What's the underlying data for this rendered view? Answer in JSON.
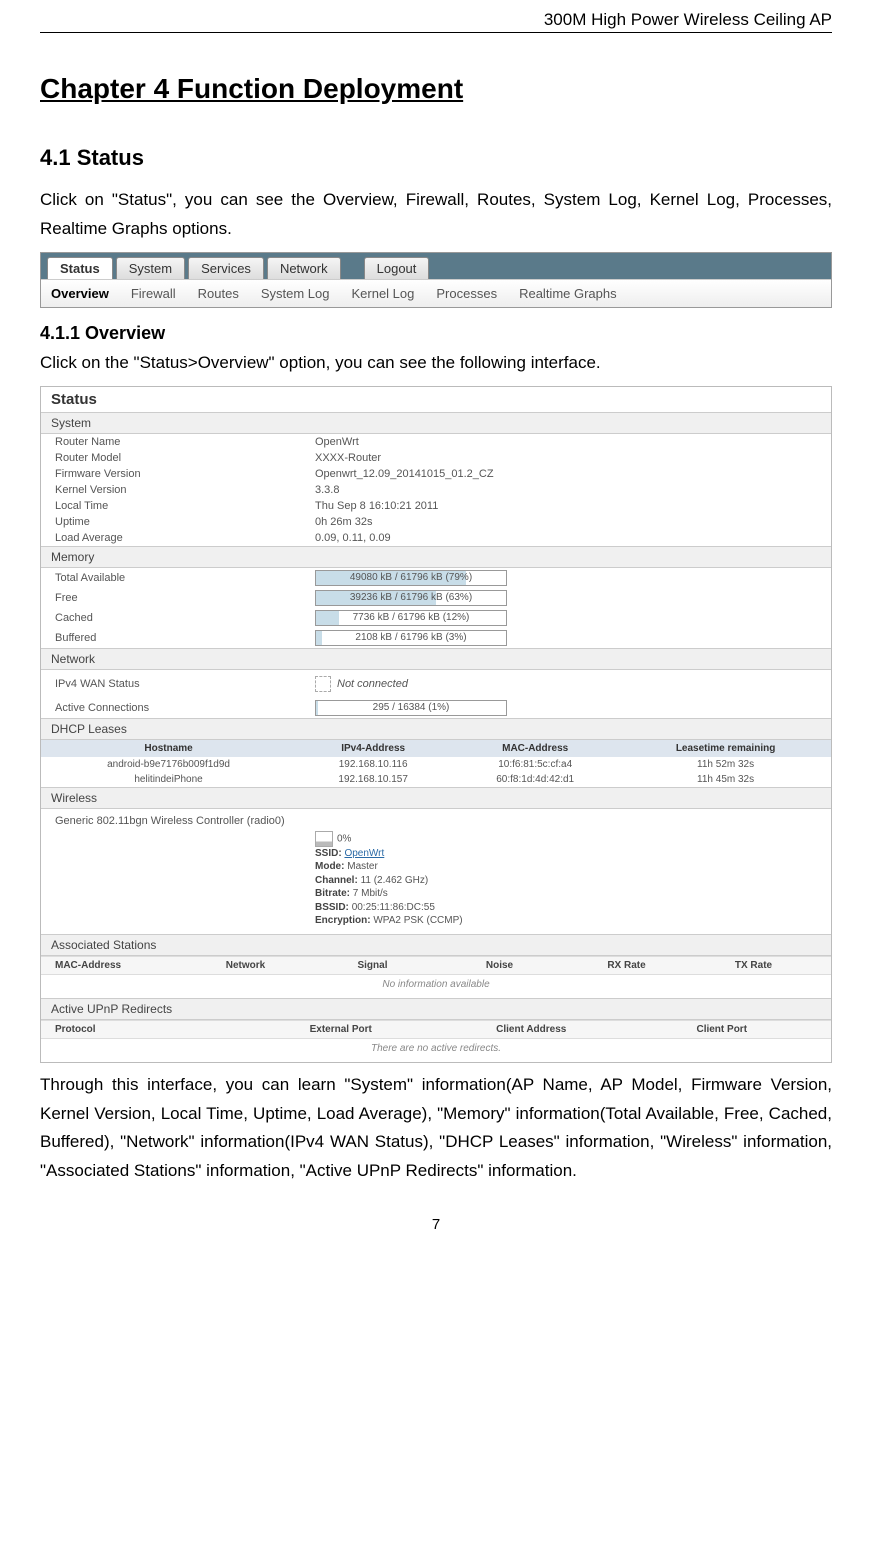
{
  "header": {
    "title": "300M High Power Wireless Ceiling AP"
  },
  "chapter": {
    "title": "Chapter 4 Function Deployment"
  },
  "section41": {
    "title": "4.1 Status",
    "body": "Click on \"Status\", you can see the Overview, Firewall, Routes, System Log, Kernel Log, Processes, Realtime Graphs options."
  },
  "screenshot1": {
    "tabs": [
      "Status",
      "System",
      "Services",
      "Network",
      "Logout"
    ],
    "subtabs": [
      "Overview",
      "Firewall",
      "Routes",
      "System Log",
      "Kernel Log",
      "Processes",
      "Realtime Graphs"
    ]
  },
  "section411": {
    "title": "4.1.1 Overview",
    "intro": "Click on the \"Status>Overview\" option, you can see the following interface."
  },
  "status": {
    "title": "Status",
    "system": {
      "heading": "System",
      "rows": [
        {
          "k": "Router Name",
          "v": "OpenWrt"
        },
        {
          "k": "Router Model",
          "v": "XXXX-Router"
        },
        {
          "k": "Firmware Version",
          "v": "Openwrt_12.09_20141015_01.2_CZ"
        },
        {
          "k": "Kernel Version",
          "v": "3.3.8"
        },
        {
          "k": "Local Time",
          "v": "Thu Sep 8 16:10:21 2011"
        },
        {
          "k": "Uptime",
          "v": "0h 26m 32s"
        },
        {
          "k": "Load Average",
          "v": "0.09, 0.11, 0.09"
        }
      ]
    },
    "memory": {
      "heading": "Memory",
      "rows": [
        {
          "k": "Total Available",
          "label": "49080 kB / 61796 kB (79%)",
          "pct": 79
        },
        {
          "k": "Free",
          "label": "39236 kB / 61796 kB (63%)",
          "pct": 63
        },
        {
          "k": "Cached",
          "label": "7736 kB / 61796 kB (12%)",
          "pct": 12
        },
        {
          "k": "Buffered",
          "label": "2108 kB / 61796 kB (3%)",
          "pct": 3
        }
      ]
    },
    "network": {
      "heading": "Network",
      "wan_label": "IPv4 WAN Status",
      "wan_value": "Not connected",
      "conn_label": "Active Connections",
      "conn_value": "295 / 16384 (1%)",
      "conn_pct": 1
    },
    "dhcp": {
      "heading": "DHCP Leases",
      "cols": [
        "Hostname",
        "IPv4-Address",
        "MAC-Address",
        "Leasetime remaining"
      ],
      "rows": [
        {
          "host": "android-b9e7176b009f1d9d",
          "ip": "192.168.10.116",
          "mac": "10:f6:81:5c:cf:a4",
          "lease": "11h 52m 32s"
        },
        {
          "host": "helitindeiPhone",
          "ip": "192.168.10.157",
          "mac": "60:f8:1d:4d:42:d1",
          "lease": "11h 45m 32s"
        }
      ]
    },
    "wireless": {
      "heading": "Wireless",
      "controller": "Generic 802.11bgn Wireless Controller (radio0)",
      "signal": "0%",
      "ssid_label": "SSID:",
      "ssid": "OpenWrt",
      "mode_label": "Mode:",
      "mode": "Master",
      "channel_label": "Channel:",
      "channel": "11 (2.462 GHz)",
      "bitrate_label": "Bitrate:",
      "bitrate": "7 Mbit/s",
      "bssid_label": "BSSID:",
      "bssid": "00:25:11:86:DC:55",
      "enc_label": "Encryption:",
      "enc": "WPA2 PSK (CCMP)"
    },
    "assoc": {
      "heading": "Associated Stations",
      "cols": [
        "MAC-Address",
        "Network",
        "Signal",
        "Noise",
        "RX Rate",
        "TX Rate"
      ],
      "empty": "No information available"
    },
    "upnp": {
      "heading": "Active UPnP Redirects",
      "cols": [
        "Protocol",
        "External Port",
        "Client Address",
        "Client Port"
      ],
      "empty": "There are no active redirects."
    }
  },
  "footer_para": "Through this interface, you can learn \"System\" information(AP Name, AP Model, Firmware Version, Kernel Version, Local Time, Uptime, Load Average), \"Memory\" information(Total Available, Free, Cached, Buffered), \"Network\" information(IPv4 WAN Status), \"DHCP Leases\" information, \"Wireless\" information, \"Associated Stations\" information, \"Active UPnP Redirects\" information.",
  "page_number": "7"
}
